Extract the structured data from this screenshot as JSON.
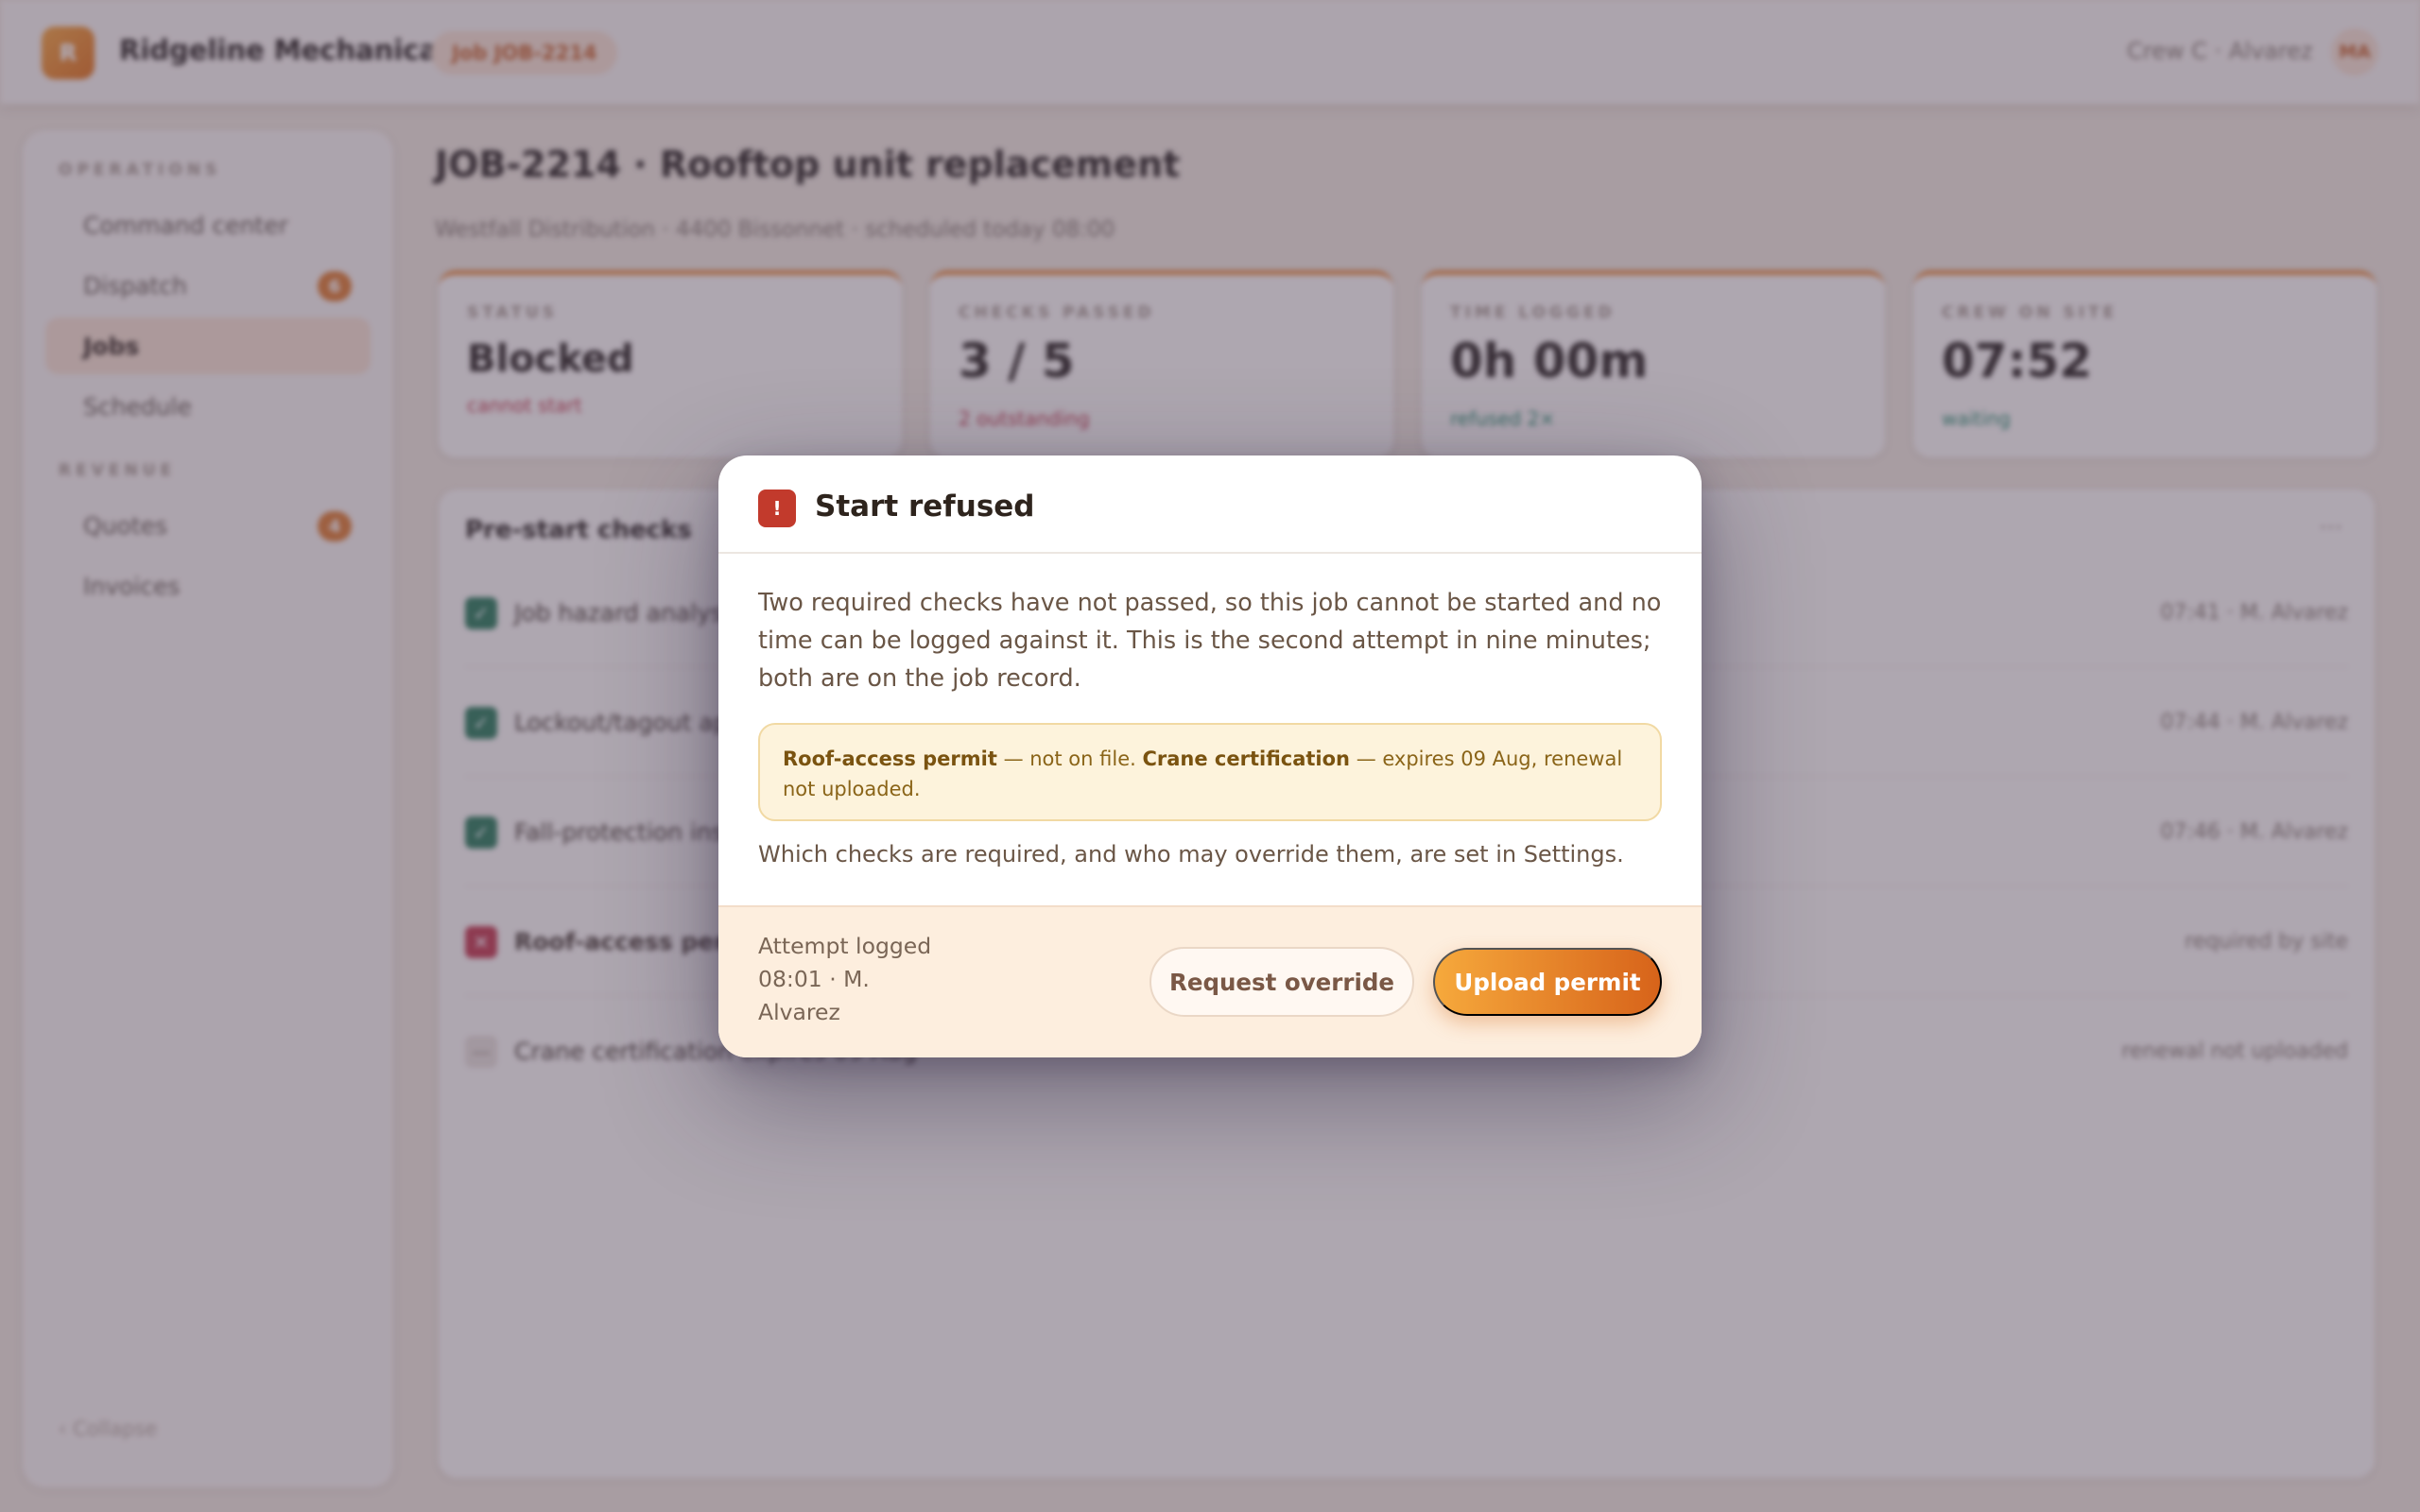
{
  "topbar": {
    "logo_letter": "R",
    "brand": "Ridgeline Mechanical",
    "job_pill": "Job JOB-2214",
    "crew_label": "Crew C · Alvarez",
    "avatar_initials": "MA"
  },
  "sidebar": {
    "sections": [
      {
        "title": "OPERATIONS"
      },
      {
        "title": "REVENUE"
      }
    ],
    "items": [
      {
        "label": "Command center"
      },
      {
        "label": "Dispatch",
        "badge": "6"
      },
      {
        "label": "Jobs",
        "active": true
      },
      {
        "label": "Schedule"
      },
      {
        "label": "Quotes",
        "badge": "4"
      },
      {
        "label": "Invoices"
      }
    ],
    "collapse": "‹ Collapse"
  },
  "page": {
    "title": "JOB-2214 · Rooftop unit replacement",
    "subtitle": "Westfall Distribution · 4400 Bissonnet · scheduled today 08:00"
  },
  "stats": [
    {
      "label": "STATUS",
      "value": "Blocked",
      "sub": "cannot start",
      "sub_color": "#c23a4a"
    },
    {
      "label": "CHECKS PASSED",
      "value": "3 / 5",
      "sub": "2 outstanding",
      "sub_color": "#c23a4a"
    },
    {
      "label": "TIME LOGGED",
      "value": "0h 00m",
      "sub": "refused 2×",
      "sub_color": "#2f8a6a"
    },
    {
      "label": "CREW ON SITE",
      "value": "07:52",
      "sub": "waiting",
      "sub_color": "#2f8a6a"
    }
  ],
  "checks": {
    "title": "Pre-start checks",
    "menu": "···",
    "rows": [
      {
        "name": "Job hazard analysis",
        "meta": "07:41 · M. Alvarez",
        "state": "pass"
      },
      {
        "name": "Lockout/tagout applied",
        "meta": "07:44 · M. Alvarez",
        "state": "pass"
      },
      {
        "name": "Fall-protection inspection",
        "meta": "07:46 · M. Alvarez",
        "state": "pass"
      },
      {
        "name": "Roof-access permit",
        "meta": "required by site",
        "state": "fail"
      },
      {
        "name": "Crane certification expires 09 Aug",
        "meta": "renewal not uploaded",
        "state": "pending"
      }
    ]
  },
  "modal": {
    "icon": "!",
    "title": "Start refused",
    "body": "Two required checks have not passed, so this job cannot be started and no time can be logged against it. This is the second attempt in nine minutes; both are on the job record.",
    "callout": {
      "item1": "Roof-access permit",
      "text1": " — not on file. ",
      "item2": "Crane certification",
      "text2": " — expires 09 Aug, renewal not uploaded."
    },
    "settings_note": "Which checks are required, and who may override them, are set in Settings.",
    "attempt": "Attempt logged 08:01 · M. Alvarez",
    "override_label": "Request override",
    "upload_label": "Upload permit"
  },
  "colors": {
    "accent": "#e0701a",
    "danger": "#c23a2c",
    "success": "#2f7a56"
  }
}
